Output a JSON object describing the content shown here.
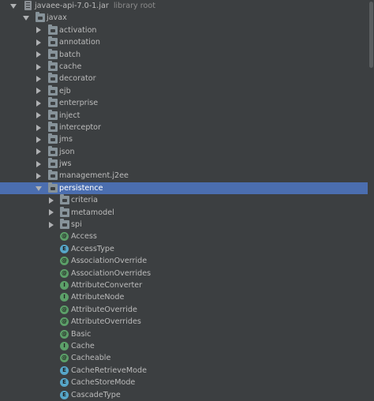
{
  "colors": {
    "background": "#3c3f41",
    "selection": "#4b6eaf",
    "text": "#bbbbbb",
    "muted_text": "#8c8c8c",
    "annotation_icon": "#5ca069",
    "enum_icon": "#56a6c9"
  },
  "tree": {
    "jar": {
      "label": "javaee-api-7.0-1.jar",
      "note": "library root",
      "icon": "jar-icon"
    },
    "root_package": {
      "label": "javax",
      "icon": "package-icon"
    },
    "packages": [
      {
        "label": "activation"
      },
      {
        "label": "annotation"
      },
      {
        "label": "batch"
      },
      {
        "label": "cache"
      },
      {
        "label": "decorator"
      },
      {
        "label": "ejb"
      },
      {
        "label": "enterprise"
      },
      {
        "label": "inject"
      },
      {
        "label": "interceptor"
      },
      {
        "label": "jms"
      },
      {
        "label": "json"
      },
      {
        "label": "jws"
      },
      {
        "label": "management.j2ee"
      }
    ],
    "selected_package": {
      "label": "persistence",
      "state": "expanded",
      "selected": true
    },
    "subpackages": [
      {
        "label": "criteria"
      },
      {
        "label": "metamodel"
      },
      {
        "label": "spi"
      }
    ],
    "classes": [
      {
        "label": "Access",
        "kind": "annotation",
        "icon_letter": "@"
      },
      {
        "label": "AccessType",
        "kind": "enum",
        "icon_letter": "E"
      },
      {
        "label": "AssociationOverride",
        "kind": "annotation",
        "icon_letter": "@"
      },
      {
        "label": "AssociationOverrides",
        "kind": "annotation",
        "icon_letter": "@"
      },
      {
        "label": "AttributeConverter",
        "kind": "interface",
        "icon_letter": "I"
      },
      {
        "label": "AttributeNode",
        "kind": "interface",
        "icon_letter": "I"
      },
      {
        "label": "AttributeOverride",
        "kind": "annotation",
        "icon_letter": "@"
      },
      {
        "label": "AttributeOverrides",
        "kind": "annotation",
        "icon_letter": "@"
      },
      {
        "label": "Basic",
        "kind": "annotation",
        "icon_letter": "@"
      },
      {
        "label": "Cache",
        "kind": "interface",
        "icon_letter": "I"
      },
      {
        "label": "Cacheable",
        "kind": "annotation",
        "icon_letter": "@"
      },
      {
        "label": "CacheRetrieveMode",
        "kind": "enum",
        "icon_letter": "E"
      },
      {
        "label": "CacheStoreMode",
        "kind": "enum",
        "icon_letter": "E"
      },
      {
        "label": "CascadeType",
        "kind": "enum",
        "icon_letter": "E"
      }
    ]
  }
}
